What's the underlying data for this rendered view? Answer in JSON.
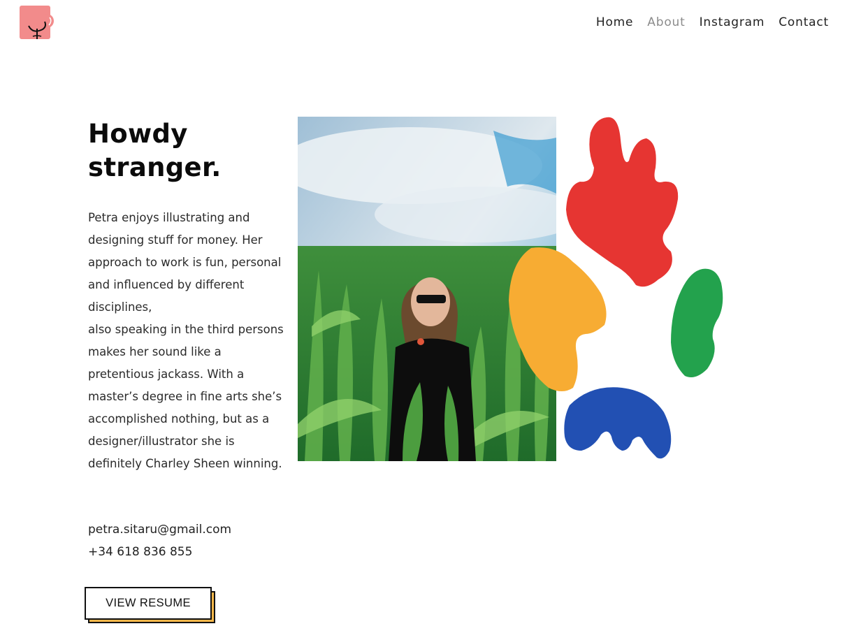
{
  "nav": {
    "items": [
      {
        "label": "Home",
        "active": false
      },
      {
        "label": "About",
        "active": true
      },
      {
        "label": "Instagram",
        "active": false
      },
      {
        "label": "Contact",
        "active": false
      }
    ]
  },
  "hero": {
    "heading_line1": "Howdy",
    "heading_line2": "stranger.",
    "bio": "Petra enjoys illustrating and designing stuff for money. Her approach to work is fun, personal and influenced by different disciplines,\nalso speaking in the third persons makes her sound like a pretentious jackass. With a master’s degree in fine arts she’s accomplished nothing, but as a designer/illustrator she is definitely Charley Sheen winning."
  },
  "contact": {
    "email": "petra.sitaru@gmail.com",
    "phone": "+34 618 836 855"
  },
  "resume_button": {
    "label": "VIEW RESUME"
  },
  "colors": {
    "accent_pink": "#f28b8b",
    "accent_yellow": "#f8b84a",
    "blob_red": "#e63532",
    "blob_yellow": "#f7ac33",
    "blob_green": "#23a24d",
    "blob_blue": "#2250b3",
    "nav_active": "#8c8c8c"
  },
  "icons": {
    "logo": "brand-logo-icon"
  }
}
